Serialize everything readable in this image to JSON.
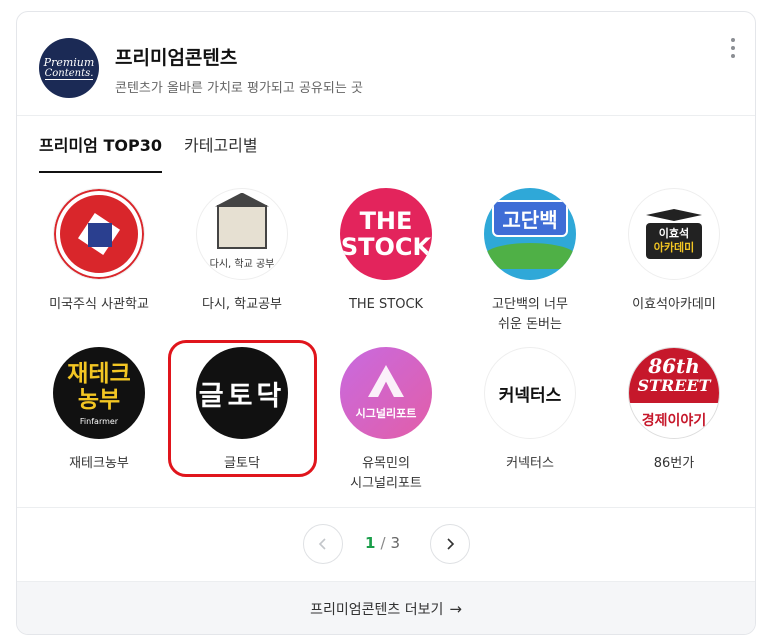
{
  "header": {
    "title": "프리미엄콘텐츠",
    "subtitle": "콘텐츠가 올바른 가치로 평가되고 공유되는 곳",
    "logo_line1": "Premium",
    "logo_line2": "Contents."
  },
  "tabs": [
    {
      "label": "프리미엄 TOP30",
      "active": true
    },
    {
      "label": "카테고리별",
      "active": false
    }
  ],
  "items": [
    {
      "name": "미국주식 사관학교"
    },
    {
      "name": "다시, 학교공부",
      "thumb_text": "다시, 학교 공부"
    },
    {
      "name": "THE STOCK",
      "thumb_text_1": "THE",
      "thumb_text_2": "STOCK"
    },
    {
      "name": "고단백의 너무 쉬운 돈버는",
      "thumb_text": "고단백"
    },
    {
      "name": "이효석아카데미",
      "thumb_text_1": "이효석",
      "thumb_text_2": "아카데미"
    },
    {
      "name": "재테크농부",
      "thumb_text_1": "재테크",
      "thumb_text_2": "농부",
      "thumb_text_3": "Finfarmer"
    },
    {
      "name": "글토닥",
      "thumb_text": "글토닥",
      "highlighted": true
    },
    {
      "name": "유목민의 시그널리포트",
      "thumb_text": "시그널리포트"
    },
    {
      "name": "커넥터스",
      "thumb_text": "커넥터스"
    },
    {
      "name": "86번가",
      "thumb_text_1": "86th",
      "thumb_text_2": "STREET",
      "thumb_text_3": "경제이야기"
    }
  ],
  "pagination": {
    "current": "1",
    "separator": "/",
    "total": "3"
  },
  "footer": {
    "label": "프리미엄콘텐츠 더보기",
    "arrow": "→"
  },
  "colors": {
    "highlight": "#e0151c",
    "current_page": "#1a9e4a"
  }
}
